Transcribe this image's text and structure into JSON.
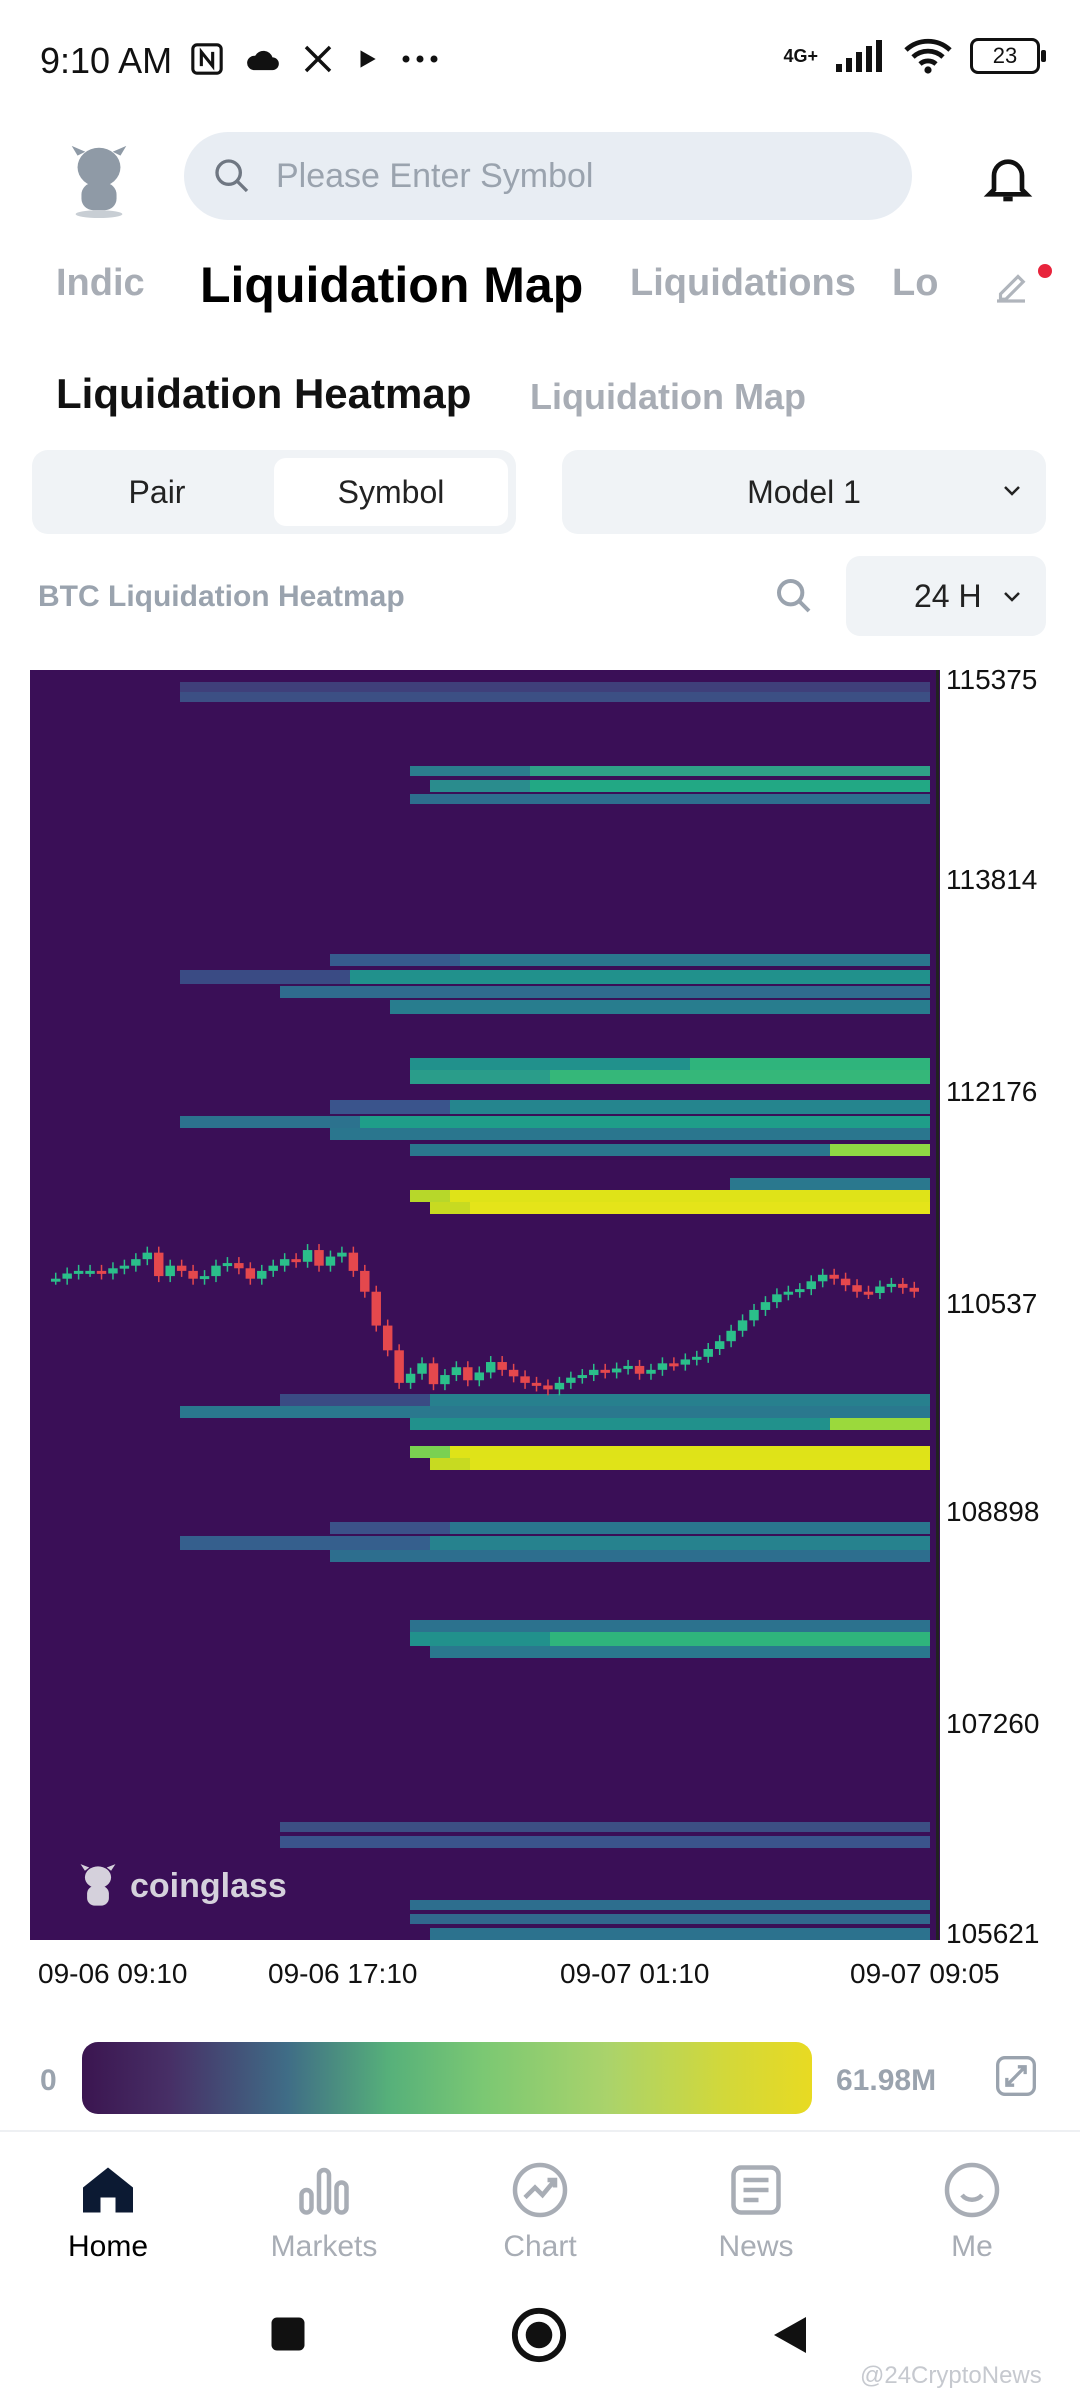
{
  "status_bar": {
    "time": "9:10 AM",
    "network": "4G+",
    "battery": "23"
  },
  "header": {
    "search_placeholder": "Please Enter Symbol"
  },
  "top_tabs": [
    "Indic",
    "Liquidation Map",
    "Liquidations",
    "Lo"
  ],
  "sub_tabs": [
    "Liquidation Heatmap",
    "Liquidation Map"
  ],
  "segment": {
    "options": [
      "Pair",
      "Symbol"
    ],
    "selected": "Symbol"
  },
  "model_select": "Model 1",
  "chart_header": {
    "title": "BTC Liquidation Heatmap",
    "range": "24 H"
  },
  "chart_data": {
    "type": "heatmap",
    "title": "BTC Liquidation Heatmap",
    "y_ticks": [
      "115375",
      "113814",
      "112176",
      "110537",
      "108898",
      "107260",
      "105621"
    ],
    "ylim": [
      105621,
      115375
    ],
    "x_ticks": [
      "09-06 09:10",
      "09-06 17:10",
      "09-07 01:10",
      "09-07 09:05"
    ],
    "colorbar": {
      "min": "0",
      "max": "61.98M"
    },
    "price_series": [
      110700,
      110740,
      110760,
      110760,
      110740,
      110780,
      110800,
      110850,
      110900,
      110720,
      110800,
      110760,
      110700,
      110720,
      110800,
      110820,
      110780,
      110700,
      110760,
      110800,
      110850,
      110830,
      110920,
      110800,
      110870,
      110900,
      110760,
      110600,
      110340,
      110150,
      109900,
      109970,
      110050,
      109890,
      109960,
      110020,
      109920,
      109980,
      110060,
      110000,
      109950,
      109900,
      109880,
      109850,
      109900,
      109940,
      109960,
      110000,
      109980,
      110010,
      110030,
      109970,
      110000,
      110050,
      110040,
      110080,
      110100,
      110160,
      110220,
      110300,
      110380,
      110460,
      110520,
      110580,
      110600,
      110620,
      110680,
      110730,
      110700,
      110650,
      110600,
      110590,
      110640,
      110660,
      110630,
      110600
    ]
  },
  "watermark": "coinglass",
  "bottom_nav": [
    "Home",
    "Markets",
    "Chart",
    "News",
    "Me"
  ],
  "colors": {
    "heat_bg": "#3a0f57",
    "up": "#2bbf8a",
    "down": "#e5484d",
    "accent_red": "#e8243c"
  },
  "credit": "@24CryptoNews"
}
